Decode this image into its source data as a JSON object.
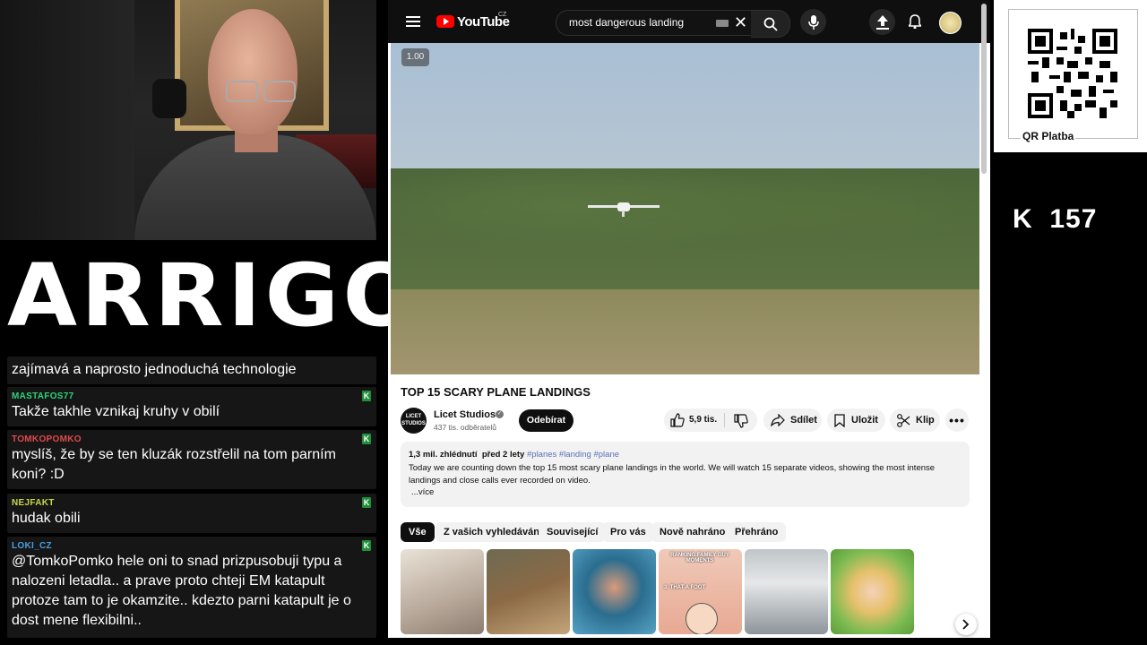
{
  "logo": {
    "text": "ARRIGOS"
  },
  "chat": [
    {
      "user": "",
      "text": "zajímavá a naprosto jednoduchá technologie",
      "color": "#ffffff",
      "badge": false
    },
    {
      "user": "MASTAFOS77",
      "text": "Takže takhle vznikaj kruhy v obilí",
      "color": "#2fd37a",
      "badge": true
    },
    {
      "user": "TOMKOPOMKO",
      "text": "myslíš, že by se ten kluzák rozstřelil na tom parním koni? :D",
      "color": "#e04a4a",
      "badge": true
    },
    {
      "user": "NEJFAKT",
      "text": "hudak obili",
      "color": "#c8d84a",
      "badge": true
    },
    {
      "user": "LOKI_CZ",
      "text": "@TomkoPomko hele oni to snad prizpusobuji typu a nalozeni letadla.. a prave proto chteji EM katapult protoze tam to je okamzite.. kdezto parni katapult je o dost mene flexibilni..",
      "color": "#4a9ee0",
      "badge": true
    }
  ],
  "badge_glyph": "K",
  "youtube": {
    "logo_text": "YouTube",
    "region": "CZ",
    "search_value": "most dangerous landing",
    "speed": "1.00",
    "video_title": "TOP 15 SCARY PLANE LANDINGS",
    "channel": {
      "avatar_text": "LICET\nSTUDIOS",
      "name": "Licet Studios",
      "subscribers": "437 tis. odběratelů",
      "subscribe_label": "Odebírat"
    },
    "actions": {
      "likes": "5,9 tis.",
      "share": "Sdílet",
      "save": "Uložit",
      "clip": "Klip"
    },
    "description": {
      "stats": "1,3 mil. zhlédnutí  před 2 lety",
      "tags": "#planes #landing #plane",
      "text": "Today we are counting down the top 15 most scary plane landings in the world. We will watch 15 separate videos, showing the most intense landings and close calls ever recorded on video.",
      "more": "...více"
    },
    "chips": [
      "Vše",
      "Z vašich vyhledávání",
      "Související",
      "Pro vás",
      "Nově nahráno",
      "Přehráno"
    ],
    "thumb_texts": [
      "RANKING FAMILY GUY MOMENTS",
      "3. THAT A FOOT"
    ]
  },
  "qr": {
    "label": "QR Platba"
  },
  "counter": {
    "text": "K  157"
  },
  "colors": {
    "yt_red": "#ff0000",
    "chat_bg": "#161616",
    "badge_green": "#1f8f3a"
  }
}
